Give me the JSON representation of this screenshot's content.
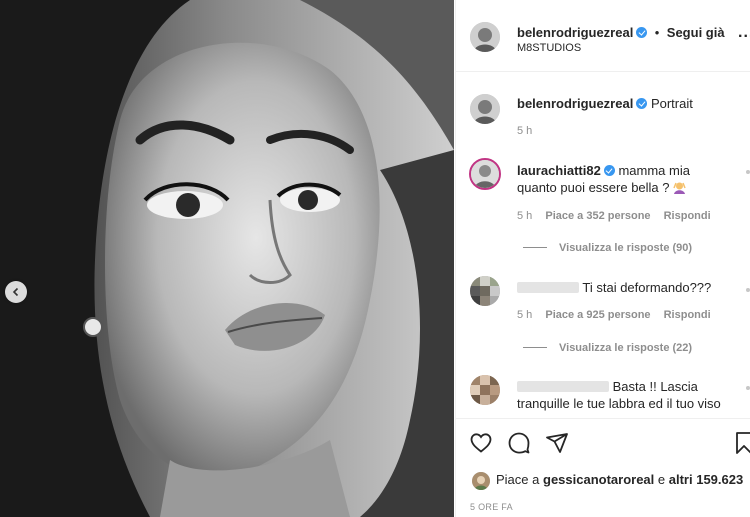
{
  "header": {
    "username": "belenrodriguezreal",
    "follow_status": "Segui già",
    "separator": "•",
    "location": "M8STUDIOS",
    "more_label": "..."
  },
  "caption": {
    "username": "belenrodriguezreal",
    "text": "Portrait",
    "time": "5 h"
  },
  "comments": [
    {
      "username": "laurachiatti82",
      "text_line1": "mamma mia",
      "text_line2": "quanto puoi essere bella ?",
      "time": "5 h",
      "likes": "Piace a 352 persone",
      "reply": "Rispondi",
      "view_replies": "Visualizza le risposte (90)"
    },
    {
      "username": "",
      "text": "Ti stai deformando???",
      "time": "5 h",
      "likes": "Piace a 925 persone",
      "reply": "Rispondi",
      "view_replies": "Visualizza le risposte (22)"
    },
    {
      "username": "",
      "text_line1": "Basta !! Lascia",
      "text_line2": "tranquille le tue labbra ed il tuo viso"
    }
  ],
  "likes": {
    "prefix": "Piace a",
    "user": "gessicanotaroreal",
    "connector": "e",
    "others": "altri 159.623"
  },
  "post_time": "5 ORE FA",
  "icons": {
    "like": "heart-icon",
    "comment": "comment-icon",
    "share": "send-icon",
    "save": "bookmark-icon",
    "prev": "chevron-left-icon"
  },
  "colors": {
    "verified": "#3897f0",
    "text": "#262626",
    "muted": "#8e8e8e",
    "border": "#efefef"
  }
}
